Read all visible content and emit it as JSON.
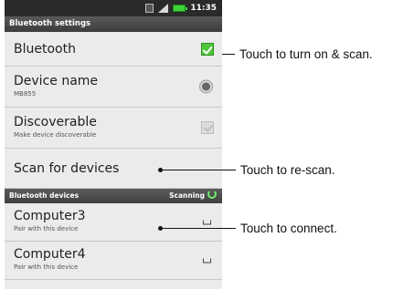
{
  "status_bar": {
    "time": "11:35"
  },
  "screen_title": "Bluetooth settings",
  "rows": {
    "bluetooth": {
      "title": "Bluetooth",
      "checked": true
    },
    "device_name": {
      "title": "Device name",
      "subtitle": "MB855"
    },
    "discoverable": {
      "title": "Discoverable",
      "subtitle": "Make device discoverable",
      "checked": false
    },
    "scan": {
      "title": "Scan for devices"
    }
  },
  "devices_section": {
    "title": "Bluetooth devices",
    "status": "Scanning"
  },
  "devices": [
    {
      "name": "Computer3",
      "subtitle": "Pair with this device"
    },
    {
      "name": "Computer4",
      "subtitle": "Pair with this device"
    }
  ],
  "callouts": {
    "bluetooth": "Touch to turn on & scan.",
    "scan": "Touch to re-scan.",
    "device": "Touch to connect."
  },
  "colors": {
    "checkbox_on": "#4fc63a",
    "header_bg": "#4a4a4a",
    "list_bg": "#ebebeb"
  }
}
